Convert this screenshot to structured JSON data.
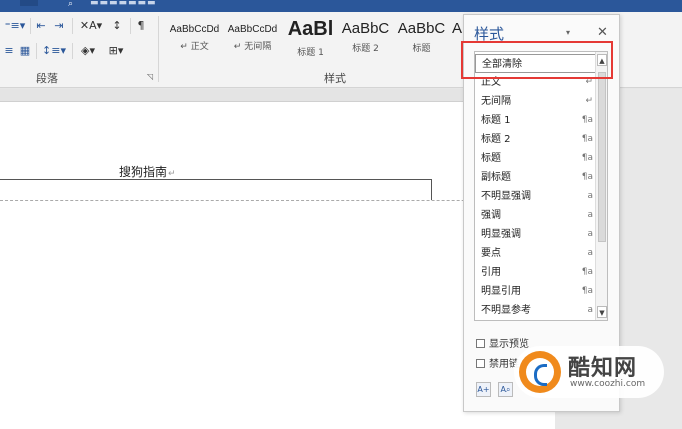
{
  "ribbon": {
    "paragraph_group_label": "段落",
    "styles_group_label": "样式",
    "tools_row1": [
      "⁼≡▾",
      "⇤",
      "⇥",
      "✕A▾",
      "↕",
      "¶"
    ],
    "tools_row2": [
      "≡",
      "▦",
      "↕≡▾",
      "◈▾",
      "⊞▾"
    ],
    "gallery": [
      {
        "sample": "AaBbCcDd",
        "caption": "↵ 正文",
        "size": "small"
      },
      {
        "sample": "AaBbCcDd",
        "caption": "↵ 无间隔",
        "size": "small"
      },
      {
        "sample": "AaBl",
        "caption": "标题 1",
        "size": "big"
      },
      {
        "sample": "AaBbC",
        "caption": "标题 2",
        "size": "mid"
      },
      {
        "sample": "AaBbC",
        "caption": "标题",
        "size": "mid"
      },
      {
        "sample": "A",
        "caption": "",
        "size": "mid"
      }
    ]
  },
  "document": {
    "text": "搜狗指南",
    "para_mark": "↵"
  },
  "styles_pane": {
    "title": "样式",
    "dropdown_icon": "▾",
    "close_icon": "✕",
    "items": [
      {
        "label": "全部清除",
        "symbol": "",
        "selected": true
      },
      {
        "label": "正文",
        "symbol": "↵"
      },
      {
        "label": "无间隔",
        "symbol": "↵"
      },
      {
        "label": "标题 1",
        "symbol": "¶a"
      },
      {
        "label": "标题 2",
        "symbol": "¶a"
      },
      {
        "label": "标题",
        "symbol": "¶a"
      },
      {
        "label": "副标题",
        "symbol": "¶a"
      },
      {
        "label": "不明显强调",
        "symbol": "a"
      },
      {
        "label": "强调",
        "symbol": "a"
      },
      {
        "label": "明显强调",
        "symbol": "a"
      },
      {
        "label": "要点",
        "symbol": "a"
      },
      {
        "label": "引用",
        "symbol": "¶a"
      },
      {
        "label": "明显引用",
        "symbol": "¶a"
      },
      {
        "label": "不明显参考",
        "symbol": "a"
      }
    ],
    "show_preview_label": "显示预览",
    "disable_linked_label": "禁用链"
  },
  "watermark": {
    "brand": "酷知网",
    "url": "www.coozhi.com"
  },
  "colors": {
    "accent": "#2b579a",
    "highlight_border": "#e53935",
    "watermark_orange": "#f08a1c"
  }
}
